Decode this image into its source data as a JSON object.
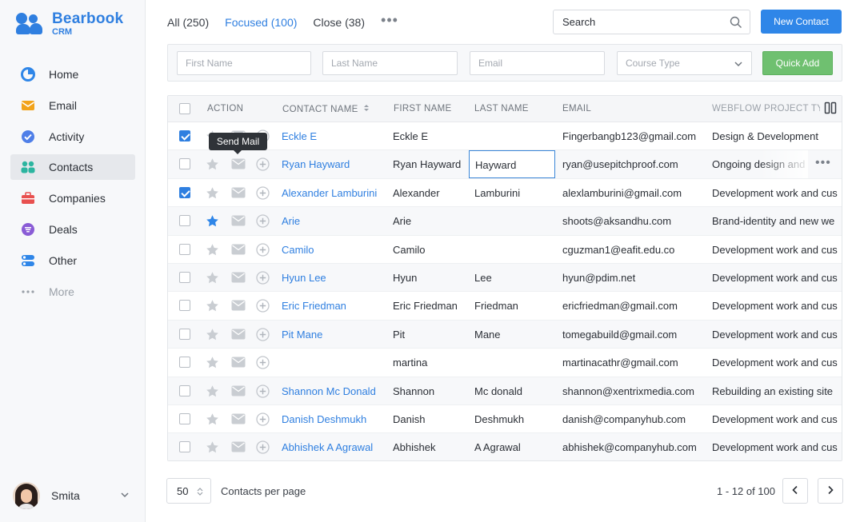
{
  "app": {
    "name": "Bearbook",
    "sub": "CRM"
  },
  "sidebar": {
    "items": [
      {
        "label": "Home",
        "icon": "home-pie-icon"
      },
      {
        "label": "Email",
        "icon": "email-icon"
      },
      {
        "label": "Activity",
        "icon": "activity-check-icon"
      },
      {
        "label": "Contacts",
        "icon": "contacts-icon",
        "active": true
      },
      {
        "label": "Companies",
        "icon": "briefcase-icon"
      },
      {
        "label": "Deals",
        "icon": "deals-filter-icon"
      },
      {
        "label": "Other",
        "icon": "other-toggle-icon"
      },
      {
        "label": "More",
        "icon": "more-dots-icon"
      }
    ],
    "user": {
      "name": "Smita"
    }
  },
  "tabs": [
    {
      "label": "All (250)"
    },
    {
      "label": "Focused (100)",
      "active": true
    },
    {
      "label": "Close (38)"
    }
  ],
  "search": {
    "placeholder": "Search"
  },
  "new_contact_label": "New Contact",
  "quick_add": {
    "first_name": "First Name",
    "last_name": "Last Name",
    "email": "Email",
    "course_type": "Course Type",
    "button": "Quick Add"
  },
  "table": {
    "headers": {
      "action": "ACTION",
      "contact_name": "CONTACT NAME",
      "first_name": "FIRST NAME",
      "last_name": "LAST NAME",
      "email": "EMAIL",
      "project": "WEBFLOW PROJECT TYPE"
    },
    "rows": [
      {
        "checked": true,
        "starred": false,
        "contact": "Eckle E",
        "first": "Eckle E",
        "last": "",
        "email": "Fingerbangb123@gmail.com",
        "project": "Design & Development"
      },
      {
        "checked": false,
        "starred": false,
        "contact": "Ryan Hayward",
        "first": "Ryan Hayward",
        "last": "Hayward",
        "email": "ryan@usepitchproof.com",
        "project": "Ongoing design and dev"
      },
      {
        "checked": true,
        "starred": false,
        "contact": "Alexander Lamburini",
        "first": "Alexander",
        "last": "Lamburini",
        "email": "alexlamburini@gmail.com",
        "project": "Development work and cus"
      },
      {
        "checked": false,
        "starred": true,
        "contact": "Arie",
        "first": "Arie",
        "last": "",
        "email": "shoots@aksandhu.com",
        "project": "Brand-identity and new we"
      },
      {
        "checked": false,
        "starred": false,
        "contact": "Camilo",
        "first": "Camilo",
        "last": "",
        "email": "cguzman1@eafit.edu.co",
        "project": "Development work and cus"
      },
      {
        "checked": false,
        "starred": false,
        "contact": "Hyun Lee",
        "first": "Hyun",
        "last": "Lee",
        "email": "hyun@pdim.net",
        "project": "Development work and cus"
      },
      {
        "checked": false,
        "starred": false,
        "contact": "Eric Friedman",
        "first": "Eric Friedman",
        "last": "Friedman",
        "email": "ericfriedman@gmail.com",
        "project": "Development work and cus"
      },
      {
        "checked": false,
        "starred": false,
        "contact": "Pit Mane",
        "first": "Pit",
        "last": "Mane",
        "email": "tomegabuild@gmail.com",
        "project": "Development work and cus"
      },
      {
        "checked": false,
        "starred": false,
        "contact": "",
        "first": "martina",
        "last": "",
        "email": "martinacathr@gmail.com",
        "project": "Development work and cus"
      },
      {
        "checked": false,
        "starred": false,
        "contact": "Shannon Mc Donald",
        "first": "Shannon",
        "last": "Mc donald",
        "email": "shannon@xentrixmedia.com",
        "project": "Rebuilding an existing site"
      },
      {
        "checked": false,
        "starred": false,
        "contact": "Danish Deshmukh",
        "first": "Danish",
        "last": "Deshmukh",
        "email": "danish@companyhub.com",
        "project": "Development work and cus"
      },
      {
        "checked": false,
        "starred": false,
        "contact": "Abhishek A Agrawal",
        "first": "Abhishek",
        "last": "A Agrawal",
        "email": "abhishek@companyhub.com",
        "project": "Development work and cus"
      }
    ]
  },
  "tooltip": "Send Mail",
  "footer": {
    "per_page_value": "50",
    "per_page_label": "Contacts per page",
    "range": "1 - 12 of 100"
  },
  "colors": {
    "primary": "#2f7fe0",
    "success": "#6fc070",
    "email": "#f2a31b",
    "deals": "#8a5cd6",
    "companies": "#e8504f",
    "contacts": "#2cb5a0"
  }
}
